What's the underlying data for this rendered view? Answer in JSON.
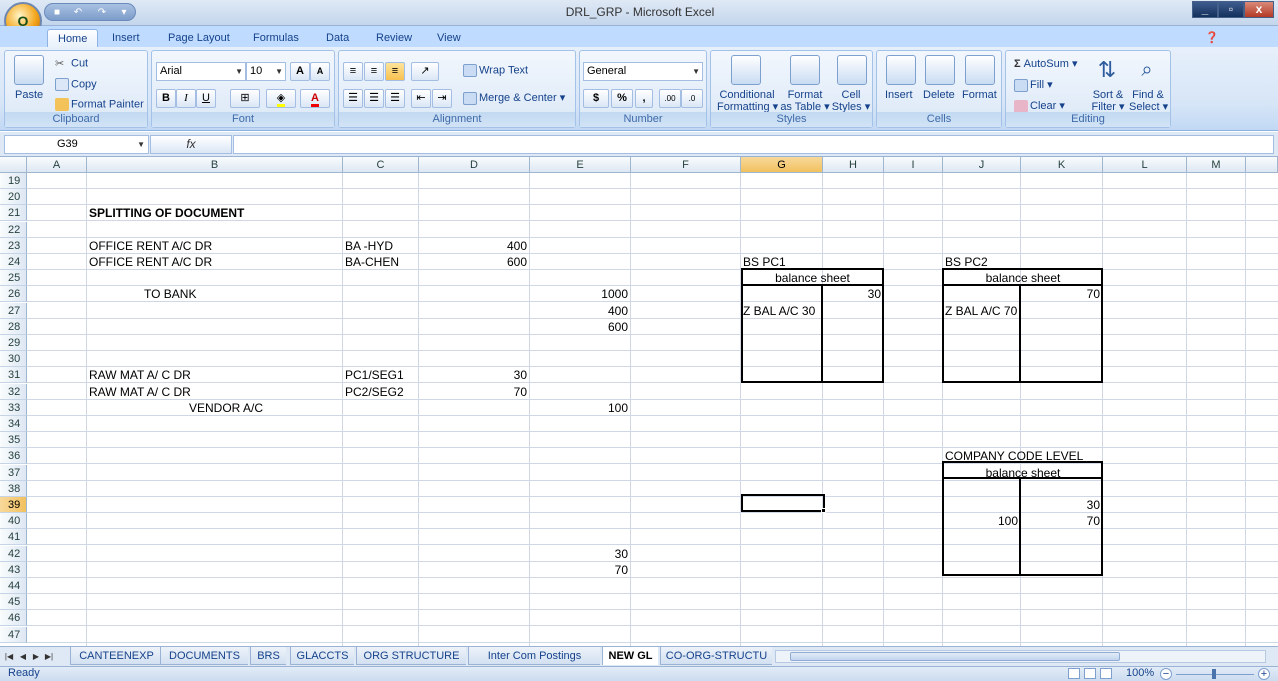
{
  "window": {
    "title": "DRL_GRP - Microsoft Excel",
    "office_button_label": "O",
    "controls": {
      "minimize": "_",
      "restore": "▫",
      "close": "x"
    }
  },
  "ribbon_tabs": [
    "Home",
    "Insert",
    "Page Layout",
    "Formulas",
    "Data",
    "Review",
    "View"
  ],
  "ribbon": {
    "clipboard": {
      "paste": "Paste",
      "cut": "Cut",
      "copy": "Copy",
      "format_painter": "Format Painter",
      "label": "Clipboard"
    },
    "font": {
      "name": "Arial",
      "size": "10",
      "bold": "B",
      "italic": "I",
      "underline": "U",
      "grow": "A",
      "shrink": "A",
      "color_letter": "A",
      "label": "Font"
    },
    "alignment": {
      "wrap_text": "Wrap Text",
      "merge_center": "Merge & Center",
      "label": "Alignment"
    },
    "number": {
      "format": "General",
      "currency": "$",
      "percent": "%",
      "comma": ",",
      "inc_decimal": ".00",
      "dec_decimal": ".0",
      "label": "Number"
    },
    "styles": {
      "conditional": "Conditional",
      "conditional2": "Formatting",
      "format_as": "Format",
      "format_as2": "as Table",
      "cell": "Cell",
      "cell2": "Styles",
      "label": "Styles"
    },
    "cells": {
      "insert": "Insert",
      "delete": "Delete",
      "format": "Format",
      "label": "Cells"
    },
    "editing": {
      "autosum": "AutoSum",
      "fill": "Fill",
      "clear": "Clear",
      "sort": "Sort &",
      "sort2": "Filter",
      "find": "Find &",
      "find2": "Select",
      "label": "Editing"
    }
  },
  "formula_bar": {
    "name_box": "G39",
    "fx": "fx",
    "value": ""
  },
  "columns": [
    "A",
    "B",
    "C",
    "D",
    "E",
    "F",
    "G",
    "H",
    "I",
    "J",
    "K",
    "L",
    "M"
  ],
  "selected_column": "G",
  "rows": [
    "19",
    "20",
    "21",
    "22",
    "23",
    "24",
    "25",
    "26",
    "27",
    "28",
    "29",
    "30",
    "31",
    "32",
    "33",
    "34",
    "35",
    "36",
    "37",
    "38",
    "39",
    "40",
    "41",
    "42",
    "43",
    "44",
    "45",
    "46",
    "47"
  ],
  "selected_row": "39",
  "cells": {
    "B21": "SPLITTING OF DOCUMENT",
    "B23": "OFFICE RENT  A/C DR",
    "C23": "BA -HYD",
    "D23": "400",
    "B24": "OFFICE RENT  A/C DR",
    "C24": "BA-CHEN",
    "D24": "600",
    "G24": "BS PC1",
    "J24": "BS PC2",
    "G25": "balance sheet",
    "J25": "balance sheet",
    "B26": "TO BANK",
    "E26": "1000",
    "H26": "30",
    "K26": "70",
    "E27": "400",
    "G27": "Z BAL A/C 30",
    "J27": "Z BAL A/C 70",
    "E28": "600",
    "B31": "RAW MAT A/ C DR",
    "C31": "PC1/SEG1",
    "D31": "30",
    "B32": "RAW MAT A/ C DR",
    "C32": "PC2/SEG2",
    "D32": "70",
    "B33": "VENDOR A/C",
    "E33": "100",
    "J36": "COMPANY CODE LEVEL",
    "J37": "balance sheet",
    "K39": "30",
    "J40": "100",
    "K40": "70",
    "E42": "30",
    "E43": "70"
  },
  "sheet_tabs": [
    "CANTEENEXP",
    "DOCUMENTS",
    "BRS",
    "GLACCTS",
    "ORG STRUCTURE",
    "Inter Com Postings",
    "NEW GL",
    "CO-ORG-STRUCTU"
  ],
  "active_sheet": "NEW GL",
  "status": {
    "mode": "Ready",
    "zoom": "100%"
  }
}
